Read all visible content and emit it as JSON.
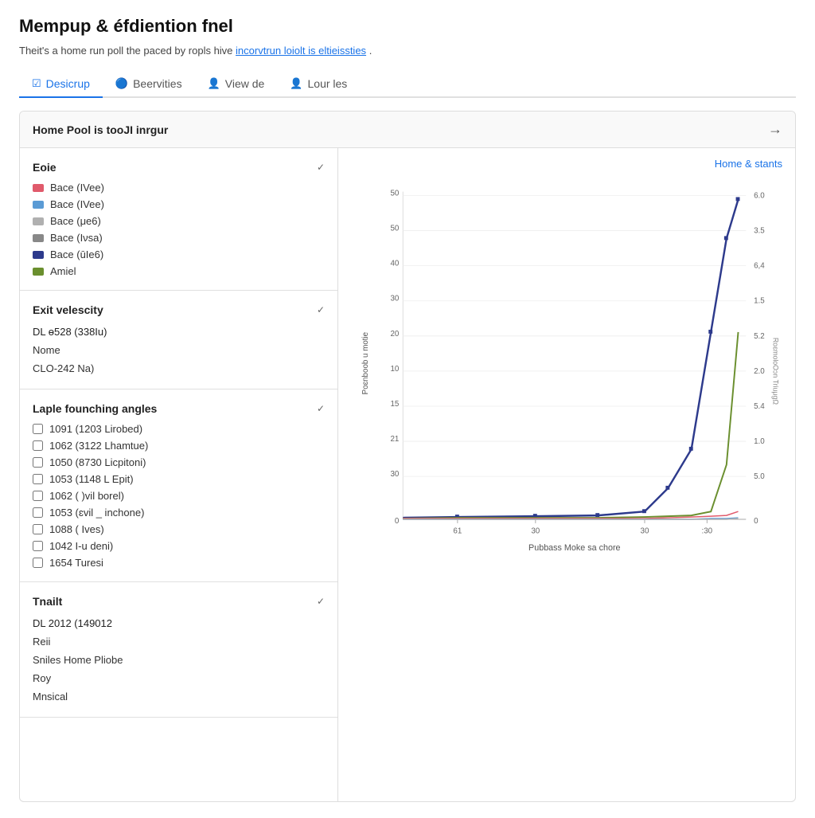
{
  "page": {
    "title": "Mempup & éfdiention fnel",
    "subtitle": "Theit's a home run poll the paced by ropls hive",
    "subtitle_link": "incorvtrun loiolt is eltieissties",
    "subtitle_end": "."
  },
  "tabs": [
    {
      "id": "desicrup",
      "label": "Desicrup",
      "icon": "☑",
      "active": true
    },
    {
      "id": "beervities",
      "label": "Beervities",
      "icon": "🔵",
      "active": false
    },
    {
      "id": "view-de",
      "label": "View de",
      "icon": "👤",
      "active": false
    },
    {
      "id": "lour-les",
      "label": "Lour les",
      "icon": "👤",
      "active": false
    }
  ],
  "panel": {
    "header": "Home Pool is tooJI inrgur",
    "arrow": "→"
  },
  "filters": {
    "role_filter": {
      "title": "Eoie",
      "legend": [
        {
          "label": "Bace (IVee)",
          "color": "#e05a6b"
        },
        {
          "label": "Bace (IVee)",
          "color": "#5b9bd5"
        },
        {
          "label": "Bace (μe6)",
          "color": "#b0b0b0"
        },
        {
          "label": "Bace (Iνsa)",
          "color": "#888888"
        },
        {
          "label": "Bace (ūIe6)",
          "color": "#2d3a8c"
        },
        {
          "label": "Amiel",
          "color": "#6a8f2e"
        }
      ]
    },
    "exit_velocity": {
      "title": "Exit velescity",
      "options": [
        {
          "label": "DL ɵ528 (338Iu)",
          "isHeader": true
        },
        {
          "label": "Nome",
          "isHeader": false
        },
        {
          "label": "CLO-242 Na)",
          "isHeader": false
        }
      ]
    },
    "launch_angles": {
      "title": "Laple founching angles",
      "items": [
        {
          "label": "1091 (1203 Lirobed)",
          "checked": false
        },
        {
          "label": "1062 (3122 Lhamtue)",
          "checked": false
        },
        {
          "label": "1050 (8730 Licpitoni)",
          "checked": false
        },
        {
          "label": "1053 (1148 L Epit)",
          "checked": false
        },
        {
          "label": "1062 ( )vil borel)",
          "checked": false
        },
        {
          "label": "1053 (ɛvil _ inchone)",
          "checked": false
        },
        {
          "label": "1088 ( Ives)",
          "checked": false
        },
        {
          "label": "1042 I-u deni)",
          "checked": false
        },
        {
          "label": "1654 Turesi",
          "checked": false
        }
      ]
    },
    "tnailt": {
      "title": "Tnailt",
      "options": [
        {
          "label": "DL 2012 (149012",
          "isHeader": true
        },
        {
          "label": "Reii",
          "isHeader": false
        },
        {
          "label": "Sniles Home Pliobe",
          "isHeader": false
        },
        {
          "label": "Roy",
          "isHeader": false
        },
        {
          "label": "Mnsical",
          "isHeader": false
        }
      ]
    }
  },
  "chart": {
    "top_label": "Home & stants",
    "y_axis_label": "Poɛnboob u motie",
    "x_axis_label": "Pubbass Moke sa chore",
    "x_ticks": [
      "61",
      "30",
      "30",
      ":30"
    ],
    "y_ticks_left": [
      "50",
      "50",
      "40",
      "30",
      "20",
      "10",
      "15",
      "21",
      "30",
      "0"
    ],
    "y_ticks_right": [
      "6.0",
      "3.5",
      "6,4",
      "1.5",
      "5.2",
      "2.0",
      "5.4",
      "1.0",
      "5.0",
      "0"
    ],
    "right_axis_vertical_label": "RoɛmoloOɔn TriuμgΩ"
  }
}
